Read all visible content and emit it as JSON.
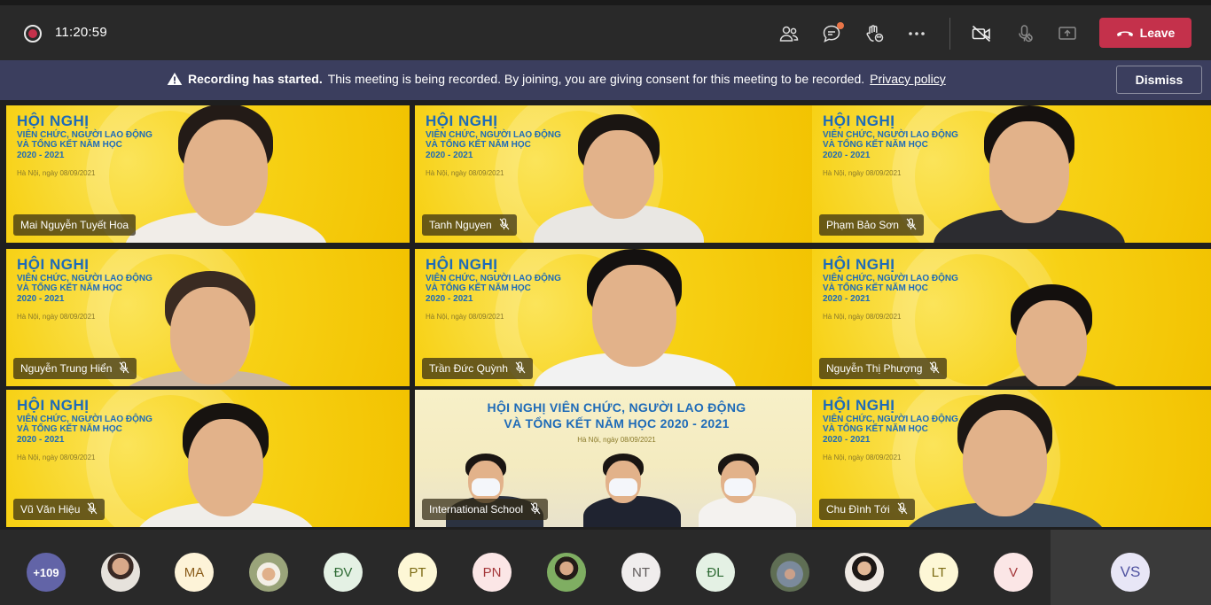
{
  "topbar": {
    "timer": "11:20:59",
    "leave_label": "Leave",
    "icons": [
      "record-icon",
      "participants-icon",
      "chat-icon",
      "reactions-icon",
      "more-icon",
      "camera-off-icon",
      "mic-off-icon",
      "share-icon",
      "phone-icon"
    ]
  },
  "banner": {
    "title": "Recording has started.",
    "message": "This meeting is being recorded. By joining, you are giving consent for this meeting to be recorded.",
    "link": "Privacy policy",
    "dismiss_label": "Dismiss"
  },
  "background": {
    "line1": "HỘI NGHỊ",
    "line2": "VIÊN CHỨC, NGƯỜI LAO ĐỘNG",
    "line3": "VÀ TỔNG KẾT NĂM HỌC",
    "line4": "2020 - 2021",
    "date": "Hà Nội, ngày 08/09/2021",
    "room_title1": "HỘI NGHỊ VIÊN CHỨC, NGƯỜI LAO ĐỘNG",
    "room_title2": "VÀ TỔNG KẾT NĂM HỌC 2020 - 2021"
  },
  "tiles": [
    {
      "name": "Mai Nguyễn Tuyết Hoa"
    },
    {
      "name": "Tanh Nguyen"
    },
    {
      "name": "Phạm Bảo Sơn"
    },
    {
      "name": "Nguyễn Trung Hiển"
    },
    {
      "name": "Trần Đức Quỳnh"
    },
    {
      "name": "Nguyễn Thị Phượng"
    },
    {
      "name": "Vũ Văn Hiệu"
    },
    {
      "name": "International School"
    },
    {
      "name": "Chu Đình Tới"
    }
  ],
  "participants": {
    "more": "+109",
    "initials": [
      "MA",
      "ĐV",
      "PT",
      "PN",
      "NT",
      "ĐL",
      "LT",
      "V"
    ],
    "self": "VS"
  },
  "colors": {
    "leave": "#c4314b",
    "banner": "#3b3e5e",
    "accent": "#6264a7",
    "tile_bg": "#f7d115"
  }
}
